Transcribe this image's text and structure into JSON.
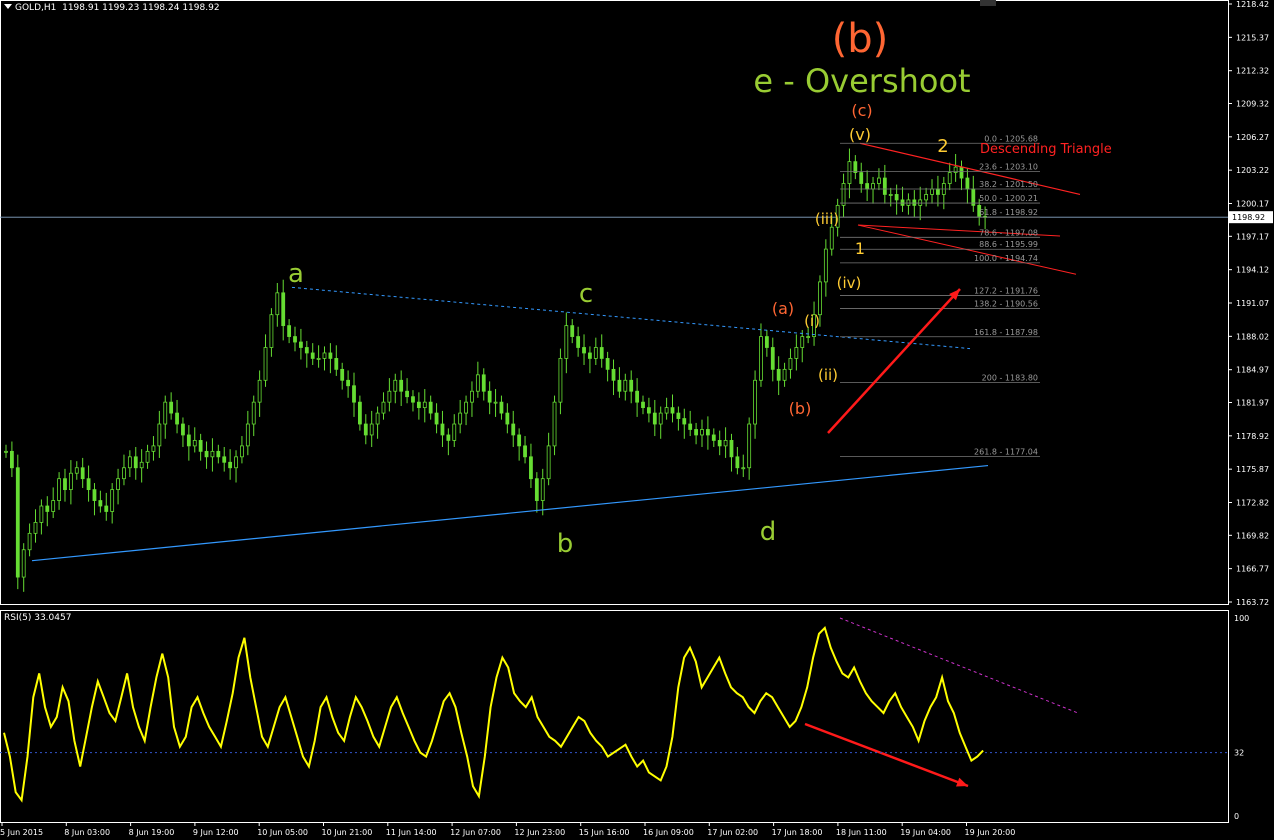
{
  "header": {
    "symbol": "GOLD,H1",
    "ohlc": "1198.91 1199.23 1198.24 1198.92"
  },
  "rsi_header": {
    "label": "RSI(5) 33.0457"
  },
  "colors": {
    "background": "#000000",
    "candle": "#66dd33",
    "grid_axis": "#ffffff",
    "trendline_blue": "#3399ff",
    "wave_green": "#99cc33",
    "wave_orange": "#ff6633",
    "wave_gold": "#ffcc33",
    "triangle_red": "#ff2222",
    "rsi_line": "#ffff00",
    "fib_gray": "#777777",
    "divergence_magenta": "#cc33cc"
  },
  "chart_data": [
    {
      "type": "candlestick",
      "title": "GOLD,H1",
      "ylim": [
        1163.72,
        1218.42
      ],
      "y_ticks": [
        "1218.42",
        "1215.37",
        "1212.32",
        "1209.32",
        "1206.27",
        "1203.22",
        "1200.17",
        "1197.17",
        "1194.12",
        "1191.07",
        "1188.02",
        "1184.97",
        "1181.97",
        "1178.92",
        "1175.87",
        "1172.82",
        "1169.82",
        "1166.77",
        "1163.72"
      ],
      "x_ticks": [
        "5 Jun 2015",
        "8 Jun 03:00",
        "8 Jun 19:00",
        "9 Jun 12:00",
        "10 Jun 05:00",
        "10 Jun 21:00",
        "11 Jun 14:00",
        "12 Jun 07:00",
        "12 Jun 23:00",
        "15 Jun 16:00",
        "16 Jun 09:00",
        "17 Jun 02:00",
        "17 Jun 18:00",
        "18 Jun 11:00",
        "19 Jun 04:00",
        "19 Jun 20:00"
      ],
      "current_price": "1198.92",
      "closes_approx": [
        1177.5,
        1176,
        1166,
        1168.5,
        1170,
        1171,
        1172.5,
        1172,
        1173,
        1175,
        1174,
        1175.5,
        1176,
        1175,
        1174,
        1173,
        1172.5,
        1172,
        1174,
        1175,
        1176,
        1177,
        1176,
        1176.5,
        1177.5,
        1178,
        1180,
        1182,
        1181,
        1180,
        1179,
        1178,
        1178.5,
        1177.5,
        1177,
        1177.5,
        1177,
        1176.5,
        1176,
        1177,
        1178,
        1180,
        1182,
        1184,
        1187,
        1190,
        1192,
        1189,
        1188,
        1187.5,
        1187,
        1186.5,
        1186,
        1186,
        1186.5,
        1186,
        1185,
        1184,
        1183.5,
        1182,
        1180,
        1179,
        1180,
        1181,
        1182,
        1183,
        1184,
        1183,
        1182.5,
        1182,
        1181.5,
        1182,
        1181,
        1180,
        1179,
        1178.5,
        1180,
        1181,
        1182,
        1183,
        1184.5,
        1183,
        1182,
        1182,
        1181,
        1180,
        1179,
        1178,
        1177,
        1175,
        1173,
        1175,
        1178,
        1182,
        1186,
        1189,
        1188,
        1187,
        1186.5,
        1186,
        1187,
        1186,
        1185,
        1184,
        1183,
        1184,
        1183,
        1182,
        1181.5,
        1181,
        1180,
        1181,
        1181.5,
        1181,
        1180.5,
        1180,
        1179.5,
        1179,
        1179.5,
        1179,
        1178.5,
        1178,
        1178.5,
        1177,
        1176,
        1176,
        1180,
        1184,
        1188,
        1187,
        1185,
        1184,
        1185,
        1186,
        1187,
        1188,
        1188,
        1190,
        1193,
        1196,
        1198,
        1200,
        1202,
        1204,
        1203,
        1202,
        1201.5,
        1202,
        1202.5,
        1201,
        1201,
        1200.5,
        1200,
        1200.5,
        1200,
        1200.5,
        1201,
        1201.5,
        1201,
        1202,
        1203,
        1203.5,
        1202.5,
        1201.5,
        1200,
        1199,
        1198.92
      ],
      "wave_labels": [
        "a",
        "b",
        "c",
        "d",
        "e - Overshoot",
        "(b)",
        "(a)",
        "(b)",
        "(c)",
        "(i)",
        "(ii)",
        "(iii)",
        "(iv)",
        "(v)",
        "1",
        "2"
      ],
      "annotation": "Descending Triangle",
      "fib_levels": [
        {
          "ratio": "0.0",
          "price": "1205.68"
        },
        {
          "ratio": "23.6",
          "price": "1203.10"
        },
        {
          "ratio": "38.2",
          "price": "1201.50"
        },
        {
          "ratio": "50.0",
          "price": "1200.21"
        },
        {
          "ratio": "61.8",
          "price": "1198.92"
        },
        {
          "ratio": "78.6",
          "price": "1197.08"
        },
        {
          "ratio": "88.6",
          "price": "1195.99"
        },
        {
          "ratio": "100.0",
          "price": "1194.74"
        },
        {
          "ratio": "127.2",
          "price": "1191.76"
        },
        {
          "ratio": "138.2",
          "price": "1190.56"
        },
        {
          "ratio": "161.8",
          "price": "1187.98"
        },
        {
          "ratio": "200",
          "price": "1183.80"
        },
        {
          "ratio": "261.8",
          "price": "1177.04"
        }
      ]
    },
    {
      "type": "line",
      "title": "RSI(5) 33.0457",
      "ylim": [
        0,
        100
      ],
      "y_ticks": [
        "100",
        "32",
        "0"
      ],
      "series": [
        {
          "name": "RSI(5)",
          "values": [
            42,
            30,
            12,
            8,
            30,
            60,
            72,
            55,
            45,
            50,
            65,
            58,
            38,
            25,
            40,
            55,
            68,
            60,
            52,
            48,
            60,
            72,
            55,
            45,
            38,
            55,
            70,
            82,
            70,
            45,
            35,
            40,
            55,
            60,
            52,
            45,
            40,
            35,
            48,
            62,
            80,
            90,
            70,
            55,
            40,
            35,
            45,
            55,
            60,
            50,
            40,
            30,
            25,
            38,
            55,
            60,
            50,
            42,
            38,
            50,
            60,
            55,
            48,
            40,
            35,
            45,
            55,
            60,
            52,
            45,
            38,
            32,
            30,
            38,
            48,
            58,
            62,
            55,
            42,
            30,
            15,
            10,
            30,
            55,
            70,
            80,
            75,
            62,
            58,
            55,
            60,
            50,
            45,
            40,
            38,
            35,
            40,
            45,
            50,
            48,
            42,
            38,
            35,
            30,
            32,
            34,
            36,
            30,
            25,
            28,
            22,
            20,
            18,
            25,
            40,
            65,
            80,
            85,
            78,
            65,
            70,
            75,
            80,
            72,
            65,
            62,
            60,
            55,
            52,
            58,
            62,
            60,
            55,
            50,
            45,
            48,
            55,
            65,
            80,
            92,
            95,
            85,
            78,
            72,
            70,
            75,
            68,
            62,
            58,
            55,
            52,
            58,
            62,
            55,
            50,
            45,
            38,
            48,
            55,
            60,
            70,
            58,
            52,
            42,
            35,
            28,
            30,
            33.0457
          ]
        }
      ],
      "reference_line": 32
    }
  ]
}
